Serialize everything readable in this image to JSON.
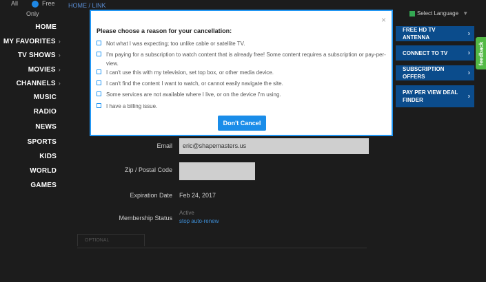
{
  "filter": {
    "all": "All",
    "free": "Free",
    "only": "Only"
  },
  "breadcrumb": {
    "home": "HOME",
    "separator": "/",
    "current": "LINK"
  },
  "sidebar": {
    "items": [
      {
        "label": "HOME",
        "chevron": ""
      },
      {
        "label": "MY FAVORITES",
        "chevron": "›"
      },
      {
        "label": "TV SHOWS",
        "chevron": "›"
      },
      {
        "label": "MOVIES",
        "chevron": "›"
      },
      {
        "label": "CHANNELS",
        "chevron": "›"
      },
      {
        "label": "MUSIC",
        "chevron": ""
      },
      {
        "label": "RADIO",
        "chevron": ""
      },
      {
        "label": "NEWS",
        "chevron": ""
      },
      {
        "label": "SPORTS",
        "chevron": ""
      },
      {
        "label": "KIDS",
        "chevron": ""
      },
      {
        "label": "WORLD",
        "chevron": ""
      },
      {
        "label": "GAMES",
        "chevron": ""
      }
    ]
  },
  "language": {
    "label": "Select Language",
    "arrow": "▼"
  },
  "right_menu": [
    {
      "label": "FREE HD TV ANTENNA"
    },
    {
      "label": "CONNECT TO TV"
    },
    {
      "label": "SUBSCRIPTION OFFERS"
    },
    {
      "label": "PAY PER VIEW DEAL FINDER"
    }
  ],
  "feedback": "feedback",
  "form": {
    "email_label": "Email",
    "email_value": "eric@shapemasters.us",
    "zip_label": "Zip / Postal Code",
    "zip_value": "",
    "expiration_label": "Expiration Date",
    "expiration_value": "Feb 24, 2017",
    "membership_label": "Membership Status",
    "membership_value": "Active",
    "auto_renew_link": "stop auto-renew",
    "tab_optional": "OPTIONAL"
  },
  "modal": {
    "close": "×",
    "title": "Please choose a reason for your cancellation:",
    "reasons": [
      "Not what I was expecting; too unlike cable or satellite TV.",
      "I'm paying for a subscription to watch content that is already free! Some content requires a subscription or pay-per-view.",
      "I can't use this with my television, set top box, or other media device.",
      "I can't find the content I want to watch, or cannot easily navigate the site.",
      "Some services are not available where I live, or on the device I'm using.",
      "I have a billing issue."
    ],
    "button": "Don't Cancel"
  },
  "colors": {
    "accent": "#2196f3",
    "button": "#1a8de9",
    "side_button": "#0b4c8c",
    "feedback": "#53b945"
  }
}
